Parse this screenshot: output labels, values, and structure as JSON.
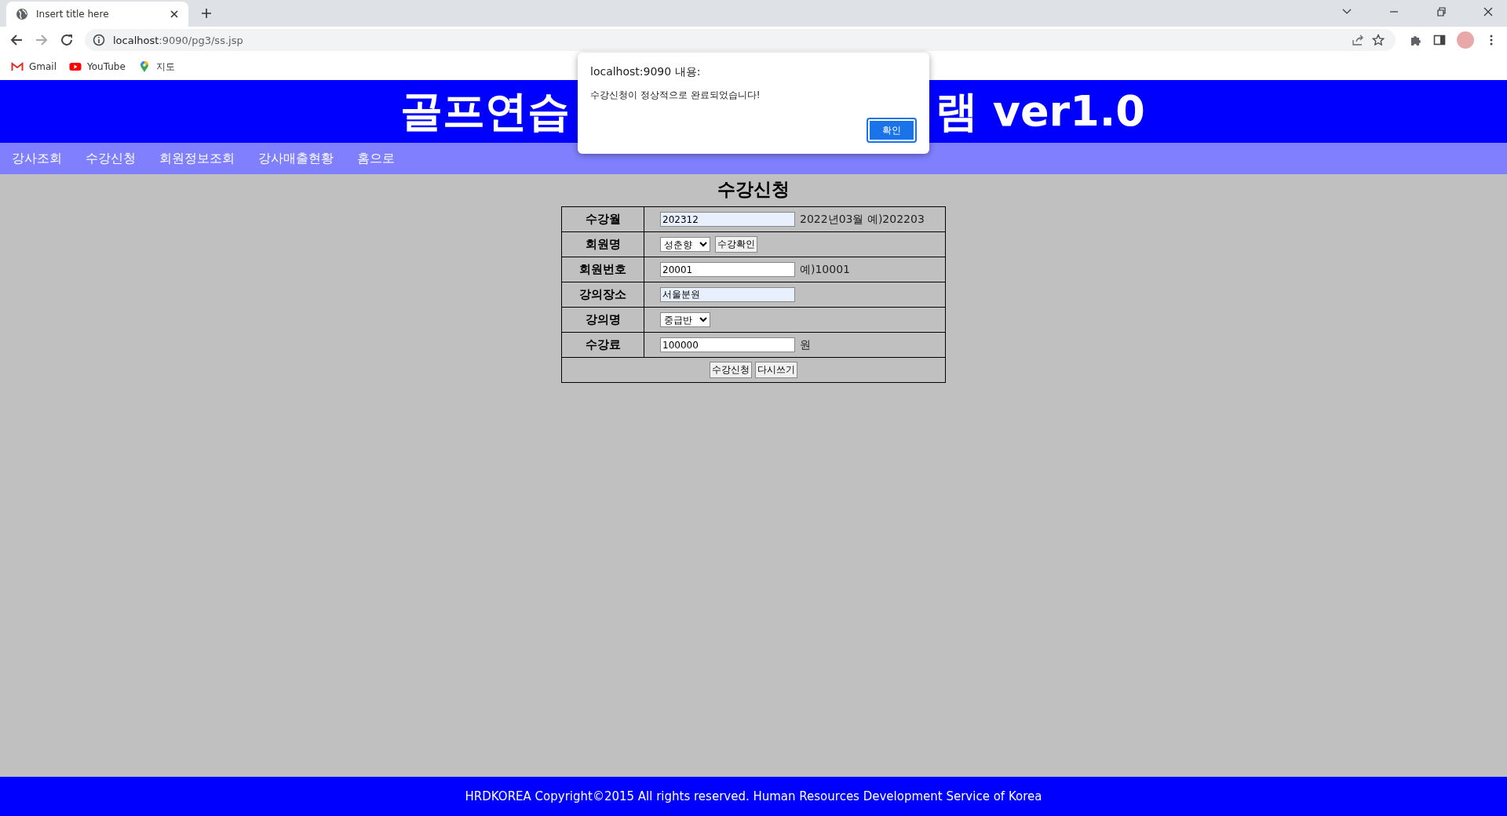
{
  "browser": {
    "tab": {
      "title": "Insert title here"
    },
    "url": {
      "host": "localhost",
      "path": ":9090/pg3/ss.jsp"
    },
    "bookmarks": [
      {
        "kind": "gmail",
        "label": "Gmail"
      },
      {
        "kind": "youtube",
        "label": "YouTube"
      },
      {
        "kind": "maps",
        "label": "지도"
      }
    ]
  },
  "header": {
    "title_left": "골프연습",
    "title_right": "램 ver1.0"
  },
  "nav": [
    "강사조회",
    "수강신청",
    "회원정보조회",
    "강사매출현황",
    "홈으로"
  ],
  "form": {
    "title": "수강신청",
    "rows": [
      {
        "label": "수강월",
        "kind": "input",
        "value": "202312",
        "autofilled": true,
        "note": "2022년03월 예)202203"
      },
      {
        "label": "회원명",
        "kind": "select",
        "value": "성춘향",
        "button": "수강확인"
      },
      {
        "label": "회원번호",
        "kind": "input",
        "value": "20001",
        "autofilled": false,
        "note": "예)10001"
      },
      {
        "label": "강의장소",
        "kind": "input",
        "value": "서울분원",
        "autofilled": true
      },
      {
        "label": "강의명",
        "kind": "select",
        "value": "중급반"
      },
      {
        "label": "수강료",
        "kind": "input",
        "value": "100000",
        "autofilled": false,
        "note": "원"
      }
    ],
    "buttons": [
      "수강신청",
      "다시쓰기"
    ]
  },
  "dialog": {
    "title": "localhost:9090 내용:",
    "message": "수강신청이 정상적으로 완료되었습니다!",
    "button": "확인"
  },
  "footer": "HRDKOREA Copyright©2015 All rights reserved. Human Resources Development Service of Korea"
}
